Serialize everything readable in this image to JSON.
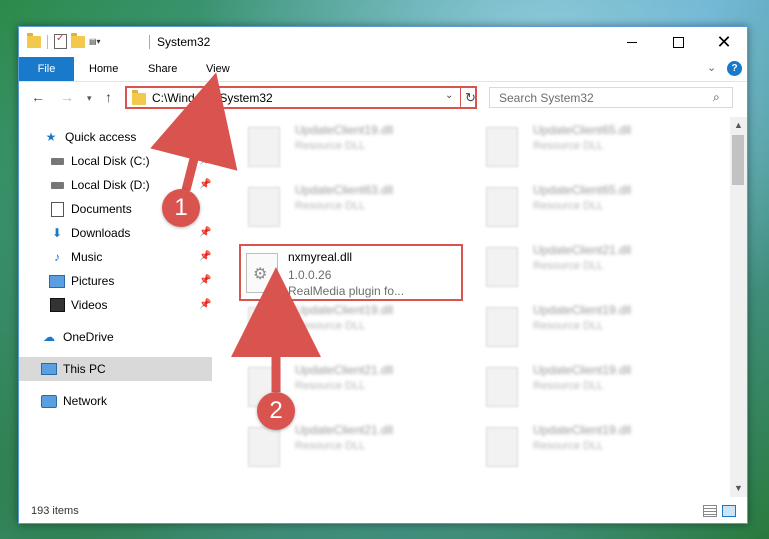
{
  "window": {
    "title": "System32",
    "controls": {
      "minimize": "—",
      "maximize": "☐",
      "close": "✕"
    }
  },
  "ribbon": {
    "tabs": [
      "File",
      "Home",
      "Share",
      "View"
    ],
    "help": "?"
  },
  "address": {
    "path": "C:\\Windows\\System32",
    "search_placeholder": "Search System32"
  },
  "nav": {
    "items": [
      {
        "label": "Quick access",
        "icon": "star-icon"
      },
      {
        "label": "Local Disk (C:)",
        "icon": "disk-icon",
        "pinned": true
      },
      {
        "label": "Local Disk (D:)",
        "icon": "disk-icon",
        "pinned": true
      },
      {
        "label": "Documents",
        "icon": "documents-icon",
        "pinned": true
      },
      {
        "label": "Downloads",
        "icon": "download-icon",
        "pinned": true
      },
      {
        "label": "Music",
        "icon": "music-icon",
        "pinned": true
      },
      {
        "label": "Pictures",
        "icon": "pictures-icon",
        "pinned": true
      },
      {
        "label": "Videos",
        "icon": "videos-icon",
        "pinned": true
      },
      {
        "label": "OneDrive",
        "icon": "onedrive-icon"
      },
      {
        "label": "This PC",
        "icon": "computer-icon",
        "selected": true
      },
      {
        "label": "Network",
        "icon": "network-icon"
      }
    ]
  },
  "files": [
    {
      "name": "UpdateClient19.dll",
      "desc": "Resource DLL"
    },
    {
      "name": "UpdateClient65.dll",
      "desc": "Resource DLL"
    },
    {
      "name": "UpdateClient63.dll",
      "desc": "Resource DLL"
    },
    {
      "name": "UpdateClient65.dll",
      "desc": "Resource DLL"
    },
    {
      "name": "UpdateClient21.dll",
      "desc": "Resource DLL"
    },
    {
      "name": "UpdateClient19.dll",
      "desc": "Resource DLL"
    },
    {
      "name": "UpdateClient19.dll",
      "desc": "Resource DLL"
    },
    {
      "name": "UpdateClient21.dll",
      "desc": "Resource DLL"
    },
    {
      "name": "UpdateClient19.dll",
      "desc": "Resource DLL"
    },
    {
      "name": "UpdateClient21.dll",
      "desc": "Resource DLL"
    },
    {
      "name": "UpdateClient19.dll",
      "desc": "Resource DLL"
    }
  ],
  "highlighted_file": {
    "name": "nxmyreal.dll",
    "version": "1.0.0.26",
    "desc": "RealMedia plugin fo..."
  },
  "status": {
    "items": "193 items"
  },
  "annotations": [
    {
      "number": "1",
      "color": "#d9534f"
    },
    {
      "number": "2",
      "color": "#d9534f"
    }
  ]
}
